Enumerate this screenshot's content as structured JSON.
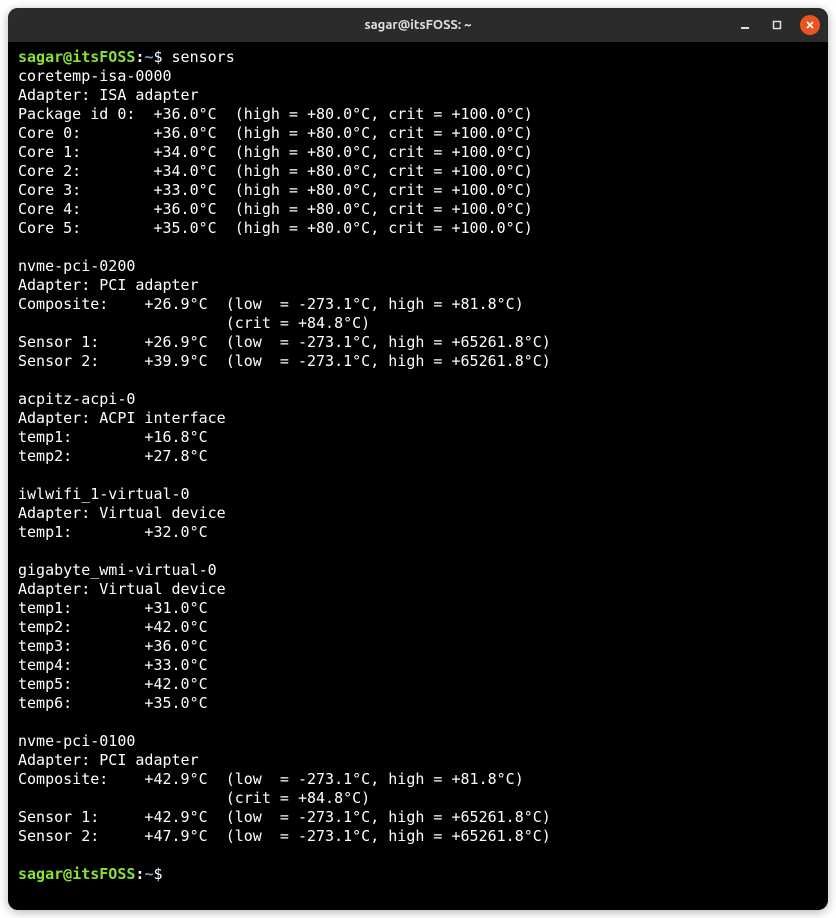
{
  "titlebar": {
    "title": "sagar@itsFOSS: ~"
  },
  "prompt": {
    "user": "sagar",
    "at": "@",
    "host": "itsFOSS",
    "colon": ":",
    "path": "~",
    "dollar": "$ "
  },
  "command": "sensors",
  "output_lines": [
    "coretemp-isa-0000",
    "Adapter: ISA adapter",
    "Package id 0:  +36.0°C  (high = +80.0°C, crit = +100.0°C)",
    "Core 0:        +36.0°C  (high = +80.0°C, crit = +100.0°C)",
    "Core 1:        +34.0°C  (high = +80.0°C, crit = +100.0°C)",
    "Core 2:        +34.0°C  (high = +80.0°C, crit = +100.0°C)",
    "Core 3:        +33.0°C  (high = +80.0°C, crit = +100.0°C)",
    "Core 4:        +36.0°C  (high = +80.0°C, crit = +100.0°C)",
    "Core 5:        +35.0°C  (high = +80.0°C, crit = +100.0°C)",
    "",
    "nvme-pci-0200",
    "Adapter: PCI adapter",
    "Composite:    +26.9°C  (low  = -273.1°C, high = +81.8°C)",
    "                       (crit = +84.8°C)",
    "Sensor 1:     +26.9°C  (low  = -273.1°C, high = +65261.8°C)",
    "Sensor 2:     +39.9°C  (low  = -273.1°C, high = +65261.8°C)",
    "",
    "acpitz-acpi-0",
    "Adapter: ACPI interface",
    "temp1:        +16.8°C",
    "temp2:        +27.8°C",
    "",
    "iwlwifi_1-virtual-0",
    "Adapter: Virtual device",
    "temp1:        +32.0°C",
    "",
    "gigabyte_wmi-virtual-0",
    "Adapter: Virtual device",
    "temp1:        +31.0°C",
    "temp2:        +42.0°C",
    "temp3:        +36.0°C",
    "temp4:        +33.0°C",
    "temp5:        +42.0°C",
    "temp6:        +35.0°C",
    "",
    "nvme-pci-0100",
    "Adapter: PCI adapter",
    "Composite:    +42.9°C  (low  = -273.1°C, high = +81.8°C)",
    "                       (crit = +84.8°C)",
    "Sensor 1:     +42.9°C  (low  = -273.1°C, high = +65261.8°C)",
    "Sensor 2:     +47.9°C  (low  = -273.1°C, high = +65261.8°C)",
    ""
  ]
}
